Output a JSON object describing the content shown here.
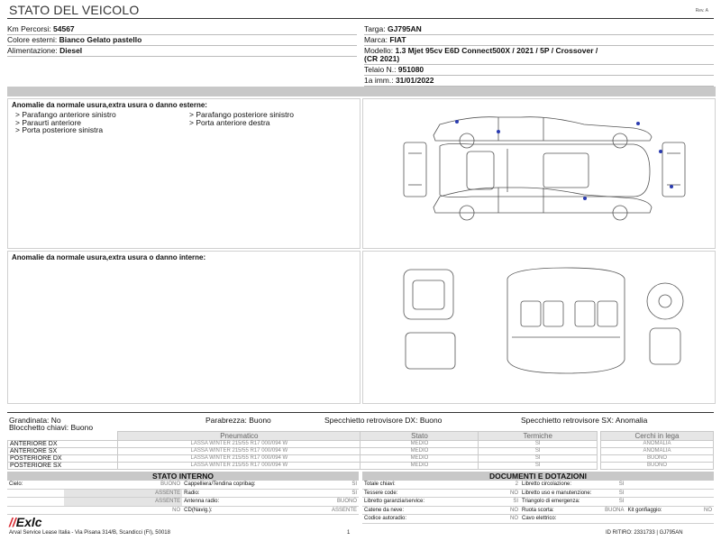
{
  "header": {
    "title": "STATO DEL VEICOLO",
    "rev": "Rev. A"
  },
  "info_left": [
    {
      "label": "Km Percorsi: ",
      "value": "54567"
    },
    {
      "label": "Colore esterni: ",
      "value": "Bianco Gelato pastello"
    },
    {
      "label": "Alimentazione: ",
      "value": "Diesel"
    }
  ],
  "info_right": [
    {
      "label": "Targa: ",
      "value": "GJ795AN"
    },
    {
      "label": "Marca: ",
      "value": "FIAT"
    },
    {
      "label": "Modello: ",
      "value": "1.3 Mjet 95cv E6D Connect500X / 2021 / 5P / Crossover /"
    },
    {
      "label": "",
      "value": "(CR 2021)"
    },
    {
      "label": "Telaio N.: ",
      "value": "951080"
    },
    {
      "label": "1a imm.: ",
      "value": "31/01/2022"
    }
  ],
  "external_damage": {
    "title": "Anomalie da normale usura,extra usura o danno esterne:",
    "col1": [
      "> Parafango anteriore sinistro",
      "> Paraurti anteriore",
      "> Porta posteriore sinistra"
    ],
    "col2": [
      "> Parafango posteriore sinistro",
      "> Porta anteriore destra"
    ]
  },
  "internal_damage": {
    "title": "Anomalie da normale usura,extra usura o danno interne:"
  },
  "summary": {
    "grandinata": "Grandinata: No",
    "parabrezza": "Parabrezza: Buono",
    "specchietto_dx": "Specchietto retrovisore DX: Buono",
    "specchietto_sx": "Specchietto retrovisore SX: Anomalia",
    "blocchetto": "Blocchetto chiavi: Buono"
  },
  "tyres": {
    "headers": [
      "Pneumatico",
      "Stato",
      "Termiche",
      "Cerchi in lega"
    ],
    "rows": [
      {
        "pos": "ANTERIORE DX",
        "tyre": "LASSA WINTER 215/55 R17 000/094 W",
        "stato": "MEDIO",
        "termiche": "SI",
        "cerchi": "ANOMALIA"
      },
      {
        "pos": "ANTERIORE SX",
        "tyre": "LASSA WINTER 215/55 R17 000/094 W",
        "stato": "MEDIO",
        "termiche": "SI",
        "cerchi": "ANOMALIA"
      },
      {
        "pos": "POSTERIORE DX",
        "tyre": "LASSA WINTER 215/55 R17 000/094 W",
        "stato": "MEDIO",
        "termiche": "SI",
        "cerchi": "BUONO"
      },
      {
        "pos": "POSTERIORE SX",
        "tyre": "LASSA WINTER 215/55 R17 000/094 W",
        "stato": "MEDIO",
        "termiche": "SI",
        "cerchi": "BUONO"
      }
    ]
  },
  "stato_interno": {
    "title": "STATO INTERNO",
    "rows": [
      {
        "l1": "Cielo:",
        "v1": "BUONO",
        "l2": "Cappelliera/Tendina copribag:",
        "v2": "SI"
      },
      {
        "l1": "",
        "v1": "ASSENTE",
        "l2": "Radio:",
        "v2": "SI"
      },
      {
        "l1": "",
        "v1": "ASSENTE",
        "l2": "Antenna radio:",
        "v2": "BUONO"
      },
      {
        "l1": "",
        "v1": "NO",
        "l2": "CD(Navig.):",
        "v2": "ASSENTE"
      }
    ]
  },
  "documenti": {
    "title": "DOCUMENTI E DOTAZIONI",
    "rows": [
      {
        "l1": "Totale chiavi:",
        "v1": "2",
        "l2": "Libretto circolazione:",
        "v2": "SI",
        "l3": "",
        "v3": ""
      },
      {
        "l1": "Tessere code:",
        "v1": "NO",
        "l2": "Libretto uso e manutenzione:",
        "v2": "SI",
        "l3": "",
        "v3": ""
      },
      {
        "l1": "Libretto garanzia/service:",
        "v1": "SI",
        "l2": "Triangolo di emergenza:",
        "v2": "SI",
        "l3": "",
        "v3": ""
      },
      {
        "l1": "Catene da neve:",
        "v1": "NO",
        "l2": "Ruota scorta:",
        "v2": "BUONA",
        "l3": "Kit gonfiaggio:",
        "v3": "NO"
      },
      {
        "l1": "Codice autoradio:",
        "v1": "NO",
        "l2": "Cavo elettrico:",
        "v2": "",
        "l3": "",
        "v3": ""
      }
    ]
  },
  "footer": {
    "logo": "Exlc",
    "address": "Arval Service Lease Italia - Via Pisana 314/B, Scandicci (FI), 50018",
    "page": "1",
    "id": "ID RITIRO: 2331733 | GJ795AN"
  },
  "colors": {
    "damage_marker": "#2a3bb0",
    "header_grey": "#c8c8c8",
    "logo_red": "#d8262e"
  }
}
